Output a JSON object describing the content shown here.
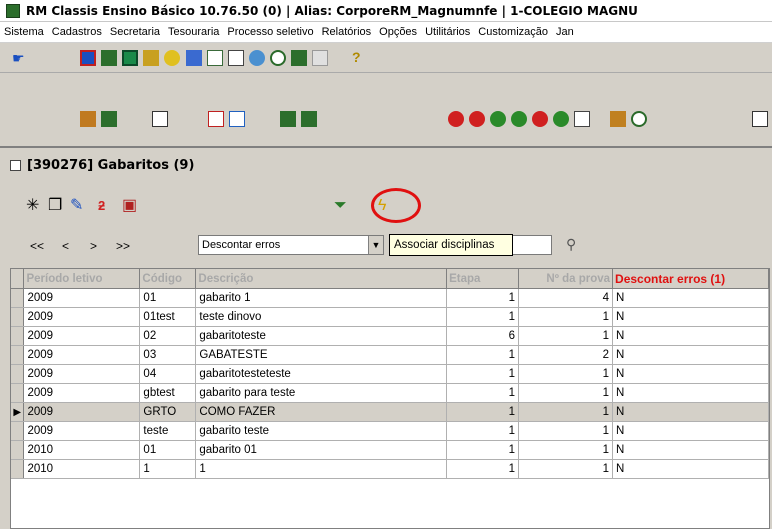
{
  "window": {
    "title": "RM Classis Ensino Básico 10.76.50 (0) | Alias: CorporeRM_Magnumnfe | 1-COLEGIO MAGNU"
  },
  "menu": {
    "items": [
      "Sistema",
      "Cadastros",
      "Secretaria",
      "Tesouraria",
      "Processo seletivo",
      "Relatórios",
      "Opções",
      "Utilitários",
      "Customização",
      "Jan"
    ]
  },
  "document": {
    "title": "[390276]  Gabaritos (9)"
  },
  "navigation": {
    "first": "<<",
    "prev": "<",
    "next": ">",
    "last": ">>"
  },
  "filter_combo": {
    "value": "Descontar erros"
  },
  "tooltip": {
    "text": "Associar disciplinas"
  },
  "grid": {
    "columns": [
      "Período letivo",
      "Código",
      "Descrição",
      "Etapa",
      "Nº da prova",
      "Descontar erros (1)"
    ],
    "rows": [
      [
        "2009",
        "01",
        "gabarito 1",
        "1",
        "4",
        "N"
      ],
      [
        "2009",
        "01test",
        "teste dinovo",
        "1",
        "1",
        "N"
      ],
      [
        "2009",
        "02",
        "gabaritoteste",
        "6",
        "1",
        "N"
      ],
      [
        "2009",
        "03",
        "GABATESTE",
        "1",
        "2",
        "N"
      ],
      [
        "2009",
        "04",
        "gabaritotesteteste",
        "1",
        "1",
        "N"
      ],
      [
        "2009",
        "gbtest",
        "gabarito para teste",
        "1",
        "1",
        "N"
      ],
      [
        "2009",
        "GRTO",
        "COMO FAZER",
        "1",
        "1",
        "N"
      ],
      [
        "2009",
        "teste",
        "gabarito teste",
        "1",
        "1",
        "N"
      ],
      [
        "2010",
        "01",
        "gabarito 01",
        "1",
        "1",
        "N"
      ],
      [
        "2010",
        "1",
        "1",
        "1",
        "1",
        "N"
      ]
    ],
    "selected_row": 6
  },
  "colors": {
    "window_bg": "#d4d0c8",
    "highlight_red": "#e01010",
    "tooltip_bg": "#ffffe1"
  }
}
